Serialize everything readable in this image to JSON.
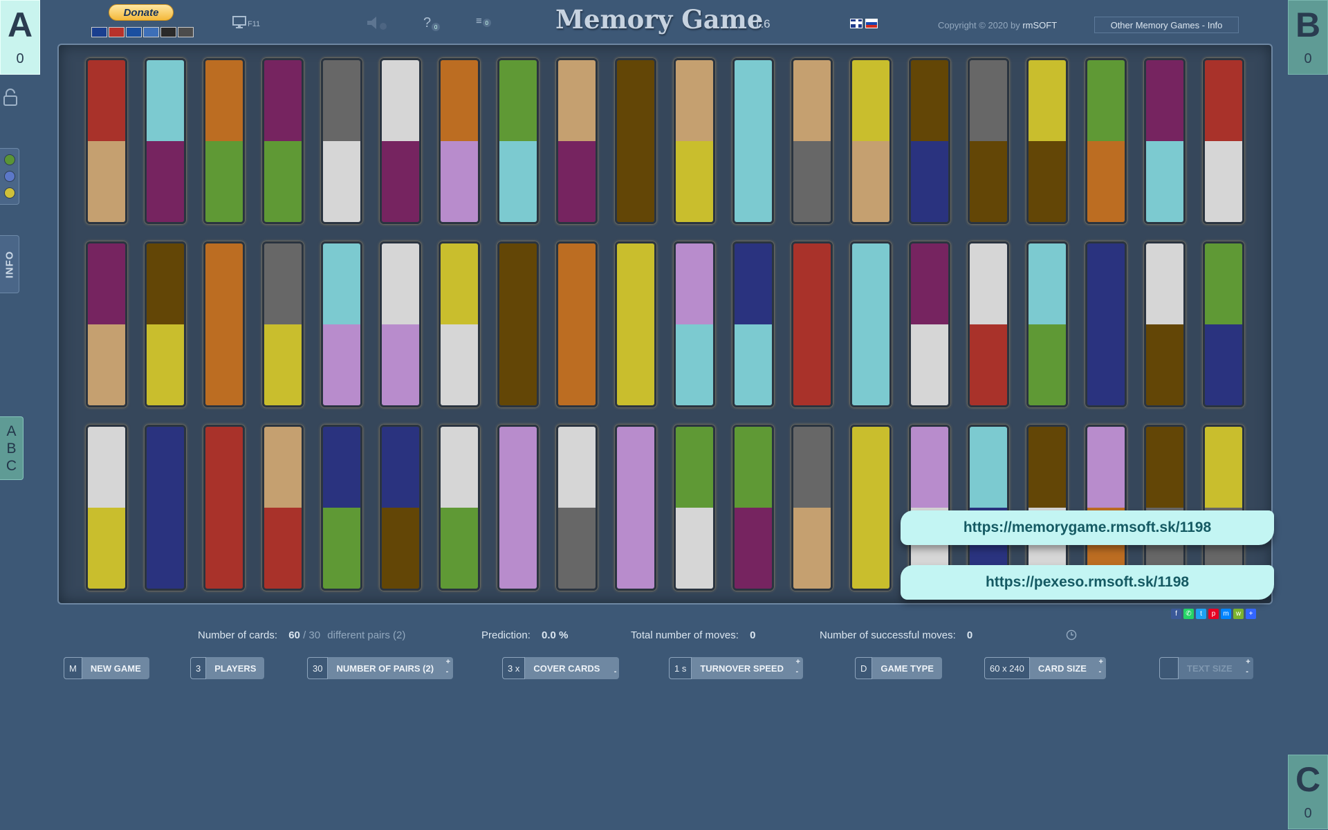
{
  "players": [
    {
      "letter": "A",
      "score": "0"
    },
    {
      "letter": "B",
      "score": "0"
    },
    {
      "letter": "C",
      "score": "0"
    }
  ],
  "sidebar": {
    "info_label": "INFO",
    "abc_label": [
      "A",
      "B",
      "C"
    ],
    "color_dots": [
      "#5a9436",
      "#5c78c8",
      "#cfc03a"
    ]
  },
  "header": {
    "donate_label": "Donate",
    "fullscreen_key": "F11",
    "help_count": "0",
    "list_count": "0",
    "title": "Memory Game",
    "version": "1.6",
    "copyright_prefix": "Copyright © 2020 by",
    "copyright_brand": "rmSOFT",
    "other_games_label": "Other Memory Games - Info"
  },
  "palette": {
    "R": "#a9322a",
    "T": "#c5a070",
    "C": "#7ccad0",
    "P": "#762460",
    "O": "#bc6d22",
    "G": "#5f9935",
    "D": "#676767",
    "W": "#d6d6d6",
    "L": "#b88ccc",
    "B": "#634606",
    "Y": "#c9be2d",
    "N": "#2a337f"
  },
  "cards": [
    [
      "RT",
      "CP",
      "OG",
      "PG",
      "DW",
      "WP",
      "OL",
      "GC",
      "TP",
      "BB",
      "TY",
      "CC",
      "TD",
      "YT",
      "BN",
      "DB",
      "YB",
      "GO",
      "PC",
      "RW"
    ],
    [
      "PT",
      "BY",
      "OO",
      "DY",
      "CL",
      "WL",
      "YW",
      "BB",
      "OO",
      "YY",
      "LC",
      "NC",
      "RR",
      "CC",
      "PW",
      "WR",
      "CG",
      "NN",
      "WB",
      "GN"
    ],
    [
      "WY",
      "NN",
      "RR",
      "TR",
      "NG",
      "NB",
      "WG",
      "LL",
      "WD",
      "LL",
      "GW",
      "GP",
      "DT",
      "YY",
      "LW",
      "CN",
      "BW",
      "LO",
      "BD",
      "YD"
    ]
  ],
  "urls": [
    "https://memorygame.rmsoft.sk/1198",
    "https://pexeso.rmsoft.sk/1198"
  ],
  "stats": {
    "cards_label": "Number of cards:",
    "cards_value": "60",
    "cards_total": "/ 30",
    "pairs_text": "different pairs (2)",
    "prediction_label": "Prediction:",
    "prediction_value": "0.0 %",
    "total_moves_label": "Total number of moves:",
    "total_moves_value": "0",
    "success_moves_label": "Number of successful moves:",
    "success_moves_value": "0"
  },
  "controls": {
    "new_game": {
      "key": "M",
      "label": "NEW GAME"
    },
    "players": {
      "key": "3",
      "label": "PLAYERS"
    },
    "pairs": {
      "key": "30",
      "label": "NUMBER OF PAIRS (2)"
    },
    "cover": {
      "key": "3 x",
      "label": "COVER CARDS"
    },
    "speed": {
      "key": "1 s",
      "label": "TURNOVER SPEED"
    },
    "game_type": {
      "key": "D",
      "label": "GAME TYPE"
    },
    "card_size": {
      "key": "60 x 240",
      "label": "CARD SIZE"
    },
    "text_size": {
      "key": "",
      "label": "TEXT SIZE"
    }
  },
  "share_colors": [
    "#3b5998",
    "#25d366",
    "#1da1f2",
    "#e60023",
    "#0084ff",
    "#7bb32e",
    "#3366ff"
  ]
}
